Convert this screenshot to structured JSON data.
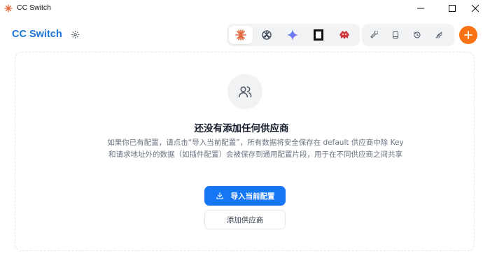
{
  "window": {
    "title": "CC Switch"
  },
  "header": {
    "brand": "CC Switch",
    "app_tabs": [
      {
        "name": "claude",
        "icon": "claude-sunburst-icon",
        "active": true
      },
      {
        "name": "openai",
        "icon": "openai-knot-icon",
        "active": false
      },
      {
        "name": "gemini",
        "icon": "gemini-star-icon",
        "active": false
      },
      {
        "name": "square",
        "icon": "square-frame-icon",
        "active": false
      },
      {
        "name": "red",
        "icon": "red-creature-icon",
        "active": false
      }
    ],
    "tools": [
      "wrench-icon",
      "book-icon",
      "history-icon",
      "signal-icon"
    ]
  },
  "empty_state": {
    "title": "还没有添加任何供应商",
    "description": "如果你已有配置，请点击“导入当前配置”，所有数据将安全保存在 default 供应商中除 Key 和请求地址外的数据（如插件配置）会被保存到通用配置片段，用于在不同供应商之间共享",
    "import_label": "导入当前配置",
    "add_label": "添加供应商"
  },
  "colors": {
    "brand": "#1a73d9",
    "primary": "#1677f5",
    "accent_add": "#f97316",
    "claude": "#e0693d",
    "red_tab": "#d0373c"
  }
}
